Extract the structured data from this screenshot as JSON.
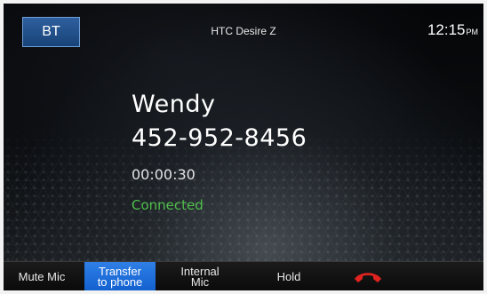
{
  "header": {
    "bt_label": "BT",
    "device_name": "HTC Desire Z",
    "time": "12:15",
    "ampm": "PM"
  },
  "call": {
    "name": "Wendy",
    "number": "452-952-8456",
    "duration": "00:00:30",
    "status": "Connected"
  },
  "actions": {
    "mute": "Mute Mic",
    "transfer_line1": "Transfer",
    "transfer_line2": "to phone",
    "internal_line1": "Internal",
    "internal_line2": "Mic",
    "hold": "Hold"
  },
  "icons": {
    "end_call": "end-call-icon"
  },
  "colors": {
    "accent_blue": "#1f6fe0",
    "status_green": "#4fbf4a",
    "end_call_red": "#e0231f"
  }
}
